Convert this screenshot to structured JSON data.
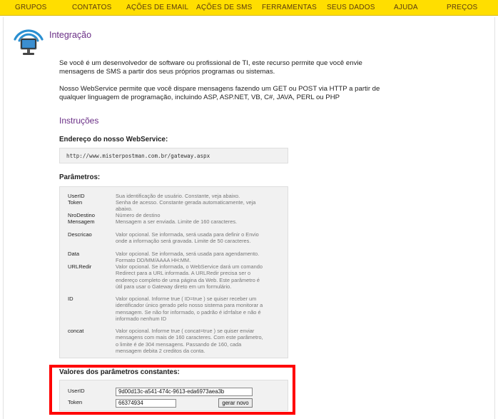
{
  "nav": {
    "items": [
      {
        "label": "GRUPOS"
      },
      {
        "label": "CONTATOS"
      },
      {
        "label": "AÇÕES DE EMAIL"
      },
      {
        "label": "AÇÕES DE SMS"
      },
      {
        "label": "FERRAMENTAS"
      },
      {
        "label": "SEUS DADOS"
      },
      {
        "label": "AJUDA"
      },
      {
        "label": "PREÇOS"
      }
    ]
  },
  "colors": {
    "nav_bg": "#ffde00",
    "nav_text": "#5a3a10",
    "title": "#6a2f86",
    "highlight_border": "#ff0000",
    "icon_blue": "#2a8fd1"
  },
  "icons": {
    "logo": "wifi-monitor-icon"
  },
  "page": {
    "title": "Integração",
    "intro_line1": "Se você é um desenvolvedor de software ou profissional de TI, este recurso permite que você envie",
    "intro_line2": "mensagens de SMS a partir dos seus próprios programas ou sistemas.",
    "webservice_line1": "Nosso WebService permite que você dispare mensagens fazendo um GET ou POST via HTTP a partir de",
    "webservice_line2": "qualquer linguagem de programação, incluindo ASP, ASP.NET, VB, C#, JAVA, PERL ou PHP",
    "instructions_title": "Instruções",
    "endpoint_label": "Endereço do nosso WebService:",
    "endpoint_url": "http://www.misterpostman.com.br/gateway.aspx",
    "params_label": "Parâmetros:"
  },
  "params": [
    {
      "name": "UserID",
      "desc": "Sua identificação de usuário. Constante, veja abaixo."
    },
    {
      "name": "Token",
      "desc": "Senha de acesso. Constante gerada automaticamente, veja abaixo."
    },
    {
      "name": "NroDestino",
      "desc": "Número de destino"
    },
    {
      "name": "Mensagem",
      "desc": "Mensagem a ser enviada. Limite de 160 caracteres."
    },
    {
      "name": "Descricao",
      "desc": "Valor opcional. Se informada, será usada para definir o Envio onde a informação será gravada. Limite de 50 caracteres."
    },
    {
      "name": "Data",
      "desc": "Valor opcional. Se informada, será usada para agendamento. Formato DD/MM/AAAA HH:MM."
    },
    {
      "name": "URLRedir",
      "desc": "Valor opcional. Se informada, o WebService dará um comando Redirect para a URL informada. A URLRedir precisa ser o endereço completo de uma página da Web. Este parâmetro é útil para usar o Gateway direto em um formulário."
    },
    {
      "name": "ID",
      "desc": "Valor opcional. Informe true ( ID=true ) se quiser receber um identificador único gerado pelo nosso sistema para monitorar a mensagem. Se não for informado, o padrão é id=false e não é informado nenhum ID"
    },
    {
      "name": "concat",
      "desc": "Valor opcional. Informe true ( concat=true ) se quiser enviar mensagens com mais de 160 caracteres. Com este parâmetro, o limite é de 304 mensagens. Passando de 160, cada mensagem debita 2 creditos da conta."
    }
  ],
  "constants": {
    "title": "Valores dos parâmetros constantes:",
    "userid_label": "UserID",
    "userid_value": "9d00d13c-a541-474c-9613-eda6973aea3b",
    "token_label": "Token",
    "token_value": "66374934",
    "regen_button": "gerar novo"
  }
}
